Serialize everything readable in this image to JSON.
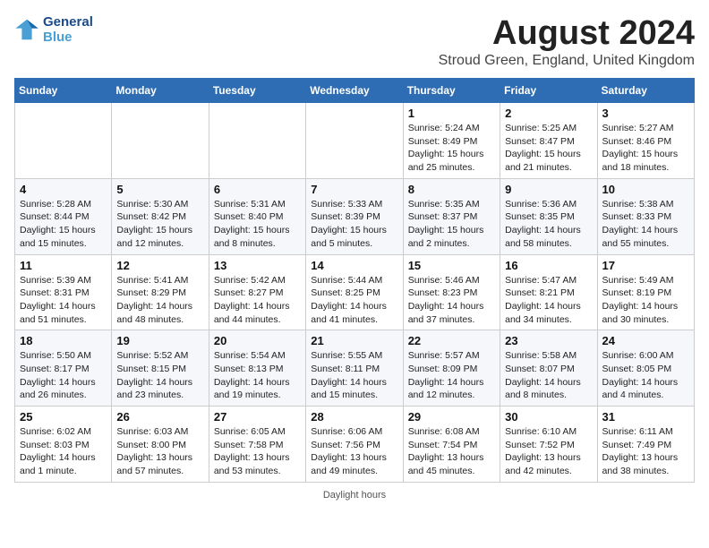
{
  "header": {
    "logo_line1": "General",
    "logo_line2": "Blue",
    "month_title": "August 2024",
    "location": "Stroud Green, England, United Kingdom"
  },
  "columns": [
    "Sunday",
    "Monday",
    "Tuesday",
    "Wednesday",
    "Thursday",
    "Friday",
    "Saturday"
  ],
  "weeks": [
    [
      {
        "day": "",
        "info": ""
      },
      {
        "day": "",
        "info": ""
      },
      {
        "day": "",
        "info": ""
      },
      {
        "day": "",
        "info": ""
      },
      {
        "day": "1",
        "info": "Sunrise: 5:24 AM\nSunset: 8:49 PM\nDaylight: 15 hours\nand 25 minutes."
      },
      {
        "day": "2",
        "info": "Sunrise: 5:25 AM\nSunset: 8:47 PM\nDaylight: 15 hours\nand 21 minutes."
      },
      {
        "day": "3",
        "info": "Sunrise: 5:27 AM\nSunset: 8:46 PM\nDaylight: 15 hours\nand 18 minutes."
      }
    ],
    [
      {
        "day": "4",
        "info": "Sunrise: 5:28 AM\nSunset: 8:44 PM\nDaylight: 15 hours\nand 15 minutes."
      },
      {
        "day": "5",
        "info": "Sunrise: 5:30 AM\nSunset: 8:42 PM\nDaylight: 15 hours\nand 12 minutes."
      },
      {
        "day": "6",
        "info": "Sunrise: 5:31 AM\nSunset: 8:40 PM\nDaylight: 15 hours\nand 8 minutes."
      },
      {
        "day": "7",
        "info": "Sunrise: 5:33 AM\nSunset: 8:39 PM\nDaylight: 15 hours\nand 5 minutes."
      },
      {
        "day": "8",
        "info": "Sunrise: 5:35 AM\nSunset: 8:37 PM\nDaylight: 15 hours\nand 2 minutes."
      },
      {
        "day": "9",
        "info": "Sunrise: 5:36 AM\nSunset: 8:35 PM\nDaylight: 14 hours\nand 58 minutes."
      },
      {
        "day": "10",
        "info": "Sunrise: 5:38 AM\nSunset: 8:33 PM\nDaylight: 14 hours\nand 55 minutes."
      }
    ],
    [
      {
        "day": "11",
        "info": "Sunrise: 5:39 AM\nSunset: 8:31 PM\nDaylight: 14 hours\nand 51 minutes."
      },
      {
        "day": "12",
        "info": "Sunrise: 5:41 AM\nSunset: 8:29 PM\nDaylight: 14 hours\nand 48 minutes."
      },
      {
        "day": "13",
        "info": "Sunrise: 5:42 AM\nSunset: 8:27 PM\nDaylight: 14 hours\nand 44 minutes."
      },
      {
        "day": "14",
        "info": "Sunrise: 5:44 AM\nSunset: 8:25 PM\nDaylight: 14 hours\nand 41 minutes."
      },
      {
        "day": "15",
        "info": "Sunrise: 5:46 AM\nSunset: 8:23 PM\nDaylight: 14 hours\nand 37 minutes."
      },
      {
        "day": "16",
        "info": "Sunrise: 5:47 AM\nSunset: 8:21 PM\nDaylight: 14 hours\nand 34 minutes."
      },
      {
        "day": "17",
        "info": "Sunrise: 5:49 AM\nSunset: 8:19 PM\nDaylight: 14 hours\nand 30 minutes."
      }
    ],
    [
      {
        "day": "18",
        "info": "Sunrise: 5:50 AM\nSunset: 8:17 PM\nDaylight: 14 hours\nand 26 minutes."
      },
      {
        "day": "19",
        "info": "Sunrise: 5:52 AM\nSunset: 8:15 PM\nDaylight: 14 hours\nand 23 minutes."
      },
      {
        "day": "20",
        "info": "Sunrise: 5:54 AM\nSunset: 8:13 PM\nDaylight: 14 hours\nand 19 minutes."
      },
      {
        "day": "21",
        "info": "Sunrise: 5:55 AM\nSunset: 8:11 PM\nDaylight: 14 hours\nand 15 minutes."
      },
      {
        "day": "22",
        "info": "Sunrise: 5:57 AM\nSunset: 8:09 PM\nDaylight: 14 hours\nand 12 minutes."
      },
      {
        "day": "23",
        "info": "Sunrise: 5:58 AM\nSunset: 8:07 PM\nDaylight: 14 hours\nand 8 minutes."
      },
      {
        "day": "24",
        "info": "Sunrise: 6:00 AM\nSunset: 8:05 PM\nDaylight: 14 hours\nand 4 minutes."
      }
    ],
    [
      {
        "day": "25",
        "info": "Sunrise: 6:02 AM\nSunset: 8:03 PM\nDaylight: 14 hours\nand 1 minute."
      },
      {
        "day": "26",
        "info": "Sunrise: 6:03 AM\nSunset: 8:00 PM\nDaylight: 13 hours\nand 57 minutes."
      },
      {
        "day": "27",
        "info": "Sunrise: 6:05 AM\nSunset: 7:58 PM\nDaylight: 13 hours\nand 53 minutes."
      },
      {
        "day": "28",
        "info": "Sunrise: 6:06 AM\nSunset: 7:56 PM\nDaylight: 13 hours\nand 49 minutes."
      },
      {
        "day": "29",
        "info": "Sunrise: 6:08 AM\nSunset: 7:54 PM\nDaylight: 13 hours\nand 45 minutes."
      },
      {
        "day": "30",
        "info": "Sunrise: 6:10 AM\nSunset: 7:52 PM\nDaylight: 13 hours\nand 42 minutes."
      },
      {
        "day": "31",
        "info": "Sunrise: 6:11 AM\nSunset: 7:49 PM\nDaylight: 13 hours\nand 38 minutes."
      }
    ]
  ],
  "footer": {
    "note": "Daylight hours"
  }
}
